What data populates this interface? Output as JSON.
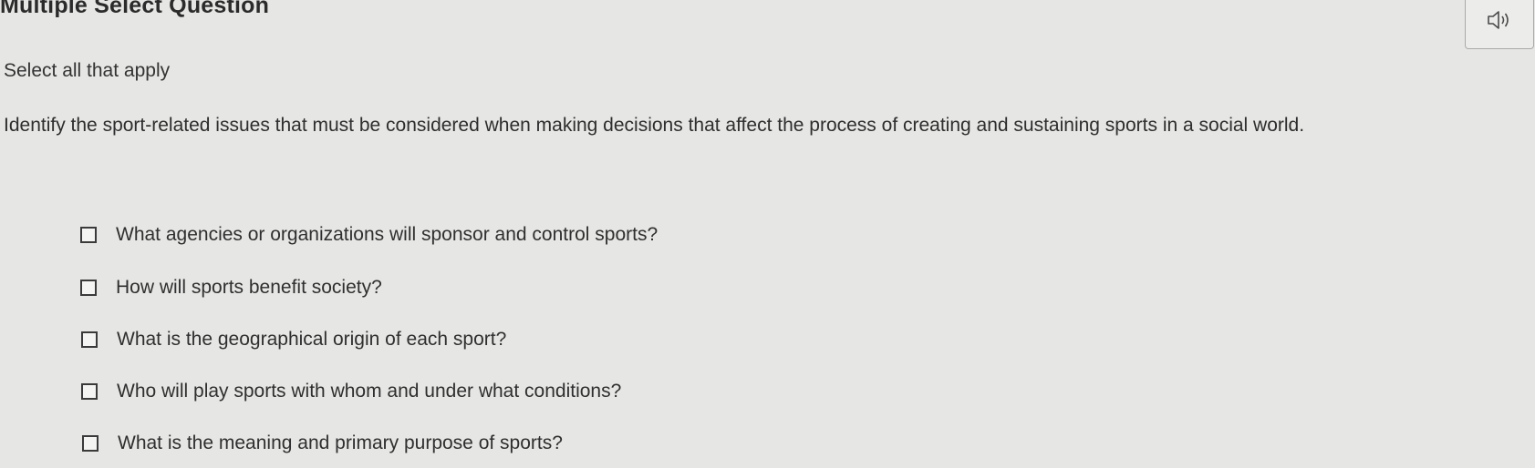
{
  "question": {
    "title": "Multiple Select Question",
    "instruction": "Select all that apply",
    "prompt": "Identify the sport-related issues that must be considered when making decisions that affect the process of creating and sustaining sports in a social world."
  },
  "audio": {
    "icon": "speaker-icon"
  },
  "options": [
    {
      "label": "What agencies or organizations will sponsor and control sports?",
      "checked": false
    },
    {
      "label": "How will sports benefit society?",
      "checked": false
    },
    {
      "label": "What is the geographical origin of each sport?",
      "checked": false
    },
    {
      "label": "Who will play sports with whom and under what conditions?",
      "checked": false
    },
    {
      "label": "What is the meaning and primary purpose of sports?",
      "checked": false
    }
  ]
}
